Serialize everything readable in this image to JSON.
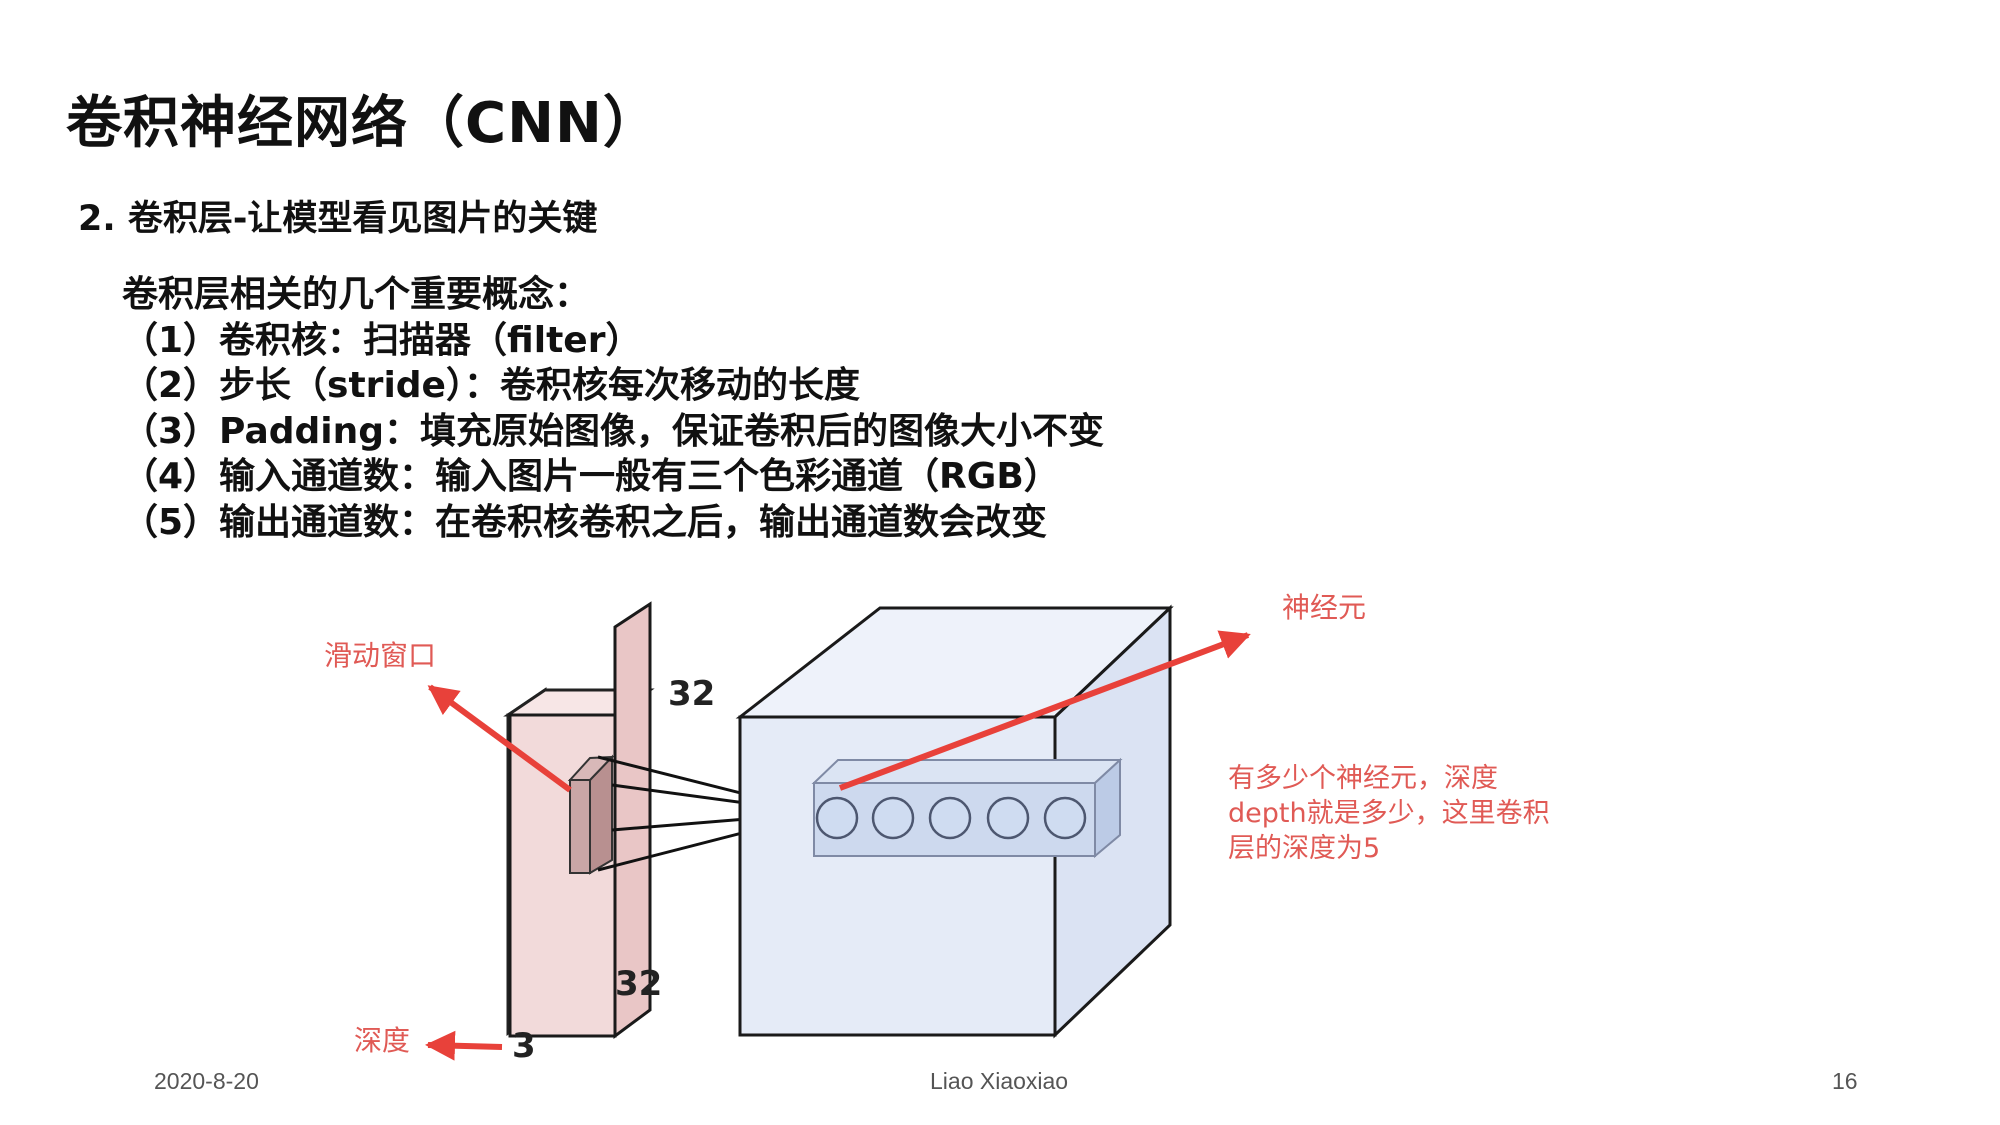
{
  "slide": {
    "title": "卷积神经网络（CNN）",
    "subtitle": "2. 卷积层-让模型看见图片的关键",
    "concepts_heading": "卷积层相关的几个重要概念：",
    "concepts": [
      "（1）卷积核：扫描器（filter）",
      "（2）步长（stride）：卷积核每次移动的长度",
      "（3）Padding：填充原始图像，保证卷积后的图像大小不变",
      "（4）输入通道数：输入图片一般有三个色彩通道（RGB）",
      "（5）输出通道数：在卷积核卷积之后，输出通道数会改变"
    ]
  },
  "figure": {
    "label_sliding_window": "滑动窗口",
    "label_depth": "深度",
    "label_neuron": "神经元",
    "label_height": "32",
    "label_width": "32",
    "label_channels": "3",
    "annotation_lines": [
      "有多少个神经元，深度",
      "depth就是多少，这里卷积",
      "层的深度为5"
    ],
    "colors": {
      "arrow": "#e8413a",
      "annotation": "#e05a55",
      "input_face": "#f4dcdc",
      "volume_face": "#e6ecf8",
      "neuron_box": "#cdd9ee"
    }
  },
  "footer": {
    "date": "2020-8-20",
    "author": "Liao Xiaoxiao",
    "page": "16"
  }
}
